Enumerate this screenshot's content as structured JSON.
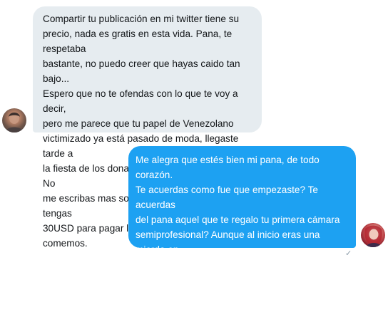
{
  "conversation": {
    "received_message": {
      "text": "Compartir tu publicación en mi twitter tiene su\nprecio, nada es gratis en esta vida. Pana, te respetaba\nbastante, no puedo creer que hayas caido tan bajo...\nEspero que no te ofendas con lo que te voy a decir,\npero me parece que tu papel de Venezolano\nvictimizado ya está pasado de moda, llegaste tarde a\nla fiesta de los donativos, mejor ponte a trabajar. No\nme escribas mas sobre esto a menos que tengas\n30USD para pagar la promo, acá tambien comemos."
    },
    "sent_message": {
      "text": "Me alegra que estés bien mi pana, de todo corazón.\nTe acuerdas como fue que empezaste? Te acuerdas\ndel pana aquel que te regalo tu primera cámara\nsemiprofesional? Aunque al inicio eras una mierda en\nla fotografía... Pero bueno, no importa, no lo hice\nesperando nada a cambio. Olvida todo esto, nunca lo\nhablamos.",
      "status_icon": "✓"
    }
  },
  "colors": {
    "received_bubble": "#e6ecf0",
    "sent_bubble": "#1da1f2",
    "received_text": "#14171a",
    "sent_text": "#ffffff",
    "status": "#8899a6"
  }
}
